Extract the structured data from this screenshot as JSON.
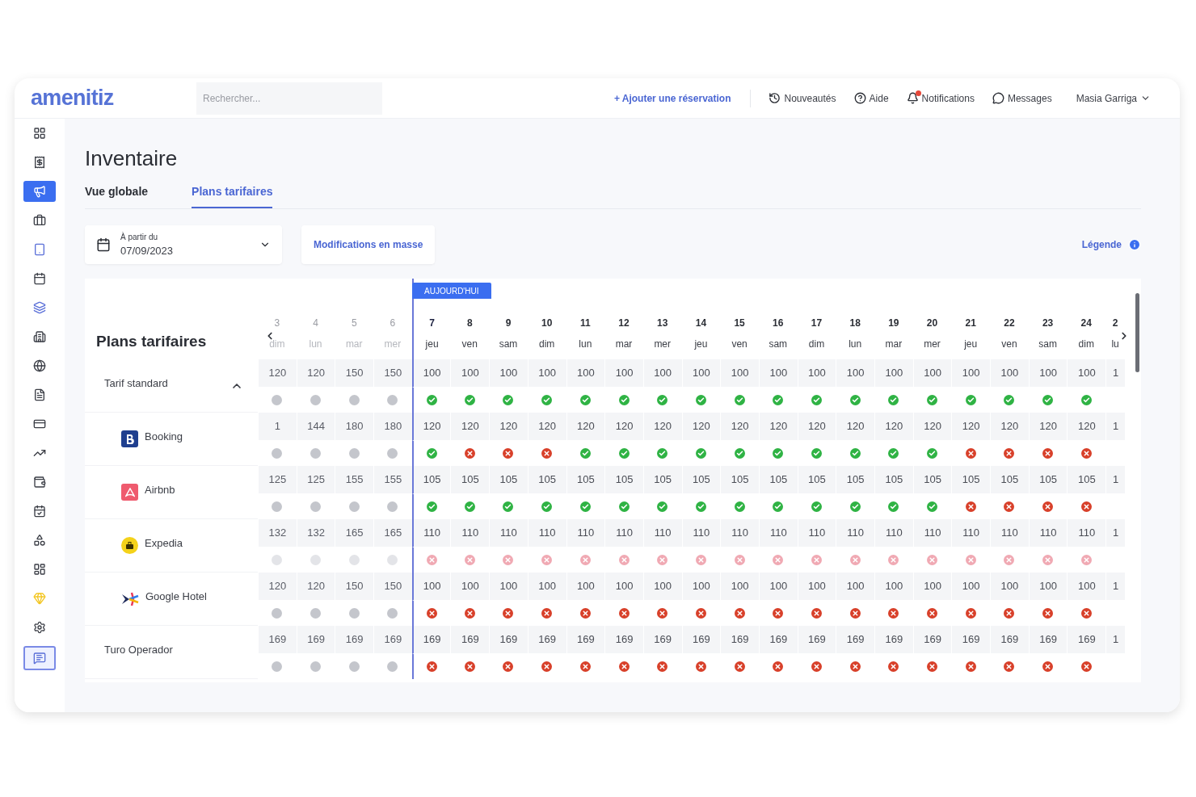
{
  "header": {
    "logo": "amenitiz",
    "search": {
      "placeholder": "Rechercher..."
    },
    "add_booking": "+ Ajouter une réservation",
    "links": [
      {
        "label": "Nouveautés",
        "badge": false
      },
      {
        "label": "Aide",
        "badge": false
      },
      {
        "label": "Notifications",
        "badge": true
      },
      {
        "label": "Messages",
        "badge": false
      }
    ],
    "user": "Masia Garriga"
  },
  "sidebar": {
    "items": [
      {
        "selected": false
      },
      {
        "selected": false
      },
      {
        "selected": true
      },
      {
        "selected": false
      },
      {
        "selected": false
      },
      {
        "selected": false
      },
      {
        "selected": false
      },
      {
        "selected": false
      },
      {
        "selected": false
      },
      {
        "selected": false
      },
      {
        "selected": false
      },
      {
        "selected": false
      },
      {
        "selected": false
      },
      {
        "selected": false
      },
      {
        "selected": false
      },
      {
        "selected": false
      },
      {
        "selected": false
      },
      {
        "selected": false
      },
      {
        "selected": false
      }
    ]
  },
  "page": {
    "title": "Inventaire",
    "tabs": [
      {
        "label": "Vue globale",
        "selected": false
      },
      {
        "label": "Plans tarifaires",
        "selected": true
      }
    ]
  },
  "toolbar": {
    "date_label": "À partir du",
    "date_value": "07/09/2023",
    "bulk_button": "Modifications en masse",
    "legend": "Légende"
  },
  "grid": {
    "heading": "Plans tarifaires",
    "today_label": "AUJOURD'HUI",
    "days": [
      {
        "day": "3",
        "weekday": "dim",
        "past": true,
        "today": false
      },
      {
        "day": "4",
        "weekday": "lun",
        "past": true,
        "today": false
      },
      {
        "day": "5",
        "weekday": "mar",
        "past": true,
        "today": false
      },
      {
        "day": "6",
        "weekday": "mer",
        "past": true,
        "today": false
      },
      {
        "day": "7",
        "weekday": "jeu",
        "past": false,
        "today": true
      },
      {
        "day": "8",
        "weekday": "ven",
        "past": false,
        "today": false
      },
      {
        "day": "9",
        "weekday": "sam",
        "past": false,
        "today": false
      },
      {
        "day": "10",
        "weekday": "dim",
        "past": false,
        "today": false
      },
      {
        "day": "11",
        "weekday": "lun",
        "past": false,
        "today": false
      },
      {
        "day": "12",
        "weekday": "mar",
        "past": false,
        "today": false
      },
      {
        "day": "13",
        "weekday": "mer",
        "past": false,
        "today": false
      },
      {
        "day": "14",
        "weekday": "jeu",
        "past": false,
        "today": false
      },
      {
        "day": "15",
        "weekday": "ven",
        "past": false,
        "today": false
      },
      {
        "day": "16",
        "weekday": "sam",
        "past": false,
        "today": false
      },
      {
        "day": "17",
        "weekday": "dim",
        "past": false,
        "today": false
      },
      {
        "day": "18",
        "weekday": "lun",
        "past": false,
        "today": false
      },
      {
        "day": "19",
        "weekday": "mar",
        "past": false,
        "today": false
      },
      {
        "day": "20",
        "weekday": "mer",
        "past": false,
        "today": false
      },
      {
        "day": "21",
        "weekday": "jeu",
        "past": false,
        "today": false
      },
      {
        "day": "22",
        "weekday": "ven",
        "past": false,
        "today": false
      },
      {
        "day": "23",
        "weekday": "sam",
        "past": false,
        "today": false
      },
      {
        "day": "24",
        "weekday": "dim",
        "past": false,
        "today": false
      },
      {
        "day": "2",
        "weekday": "lu",
        "past": false,
        "today": false
      }
    ],
    "rate_plans": [
      {
        "name": "Tarif standard",
        "expanded": true,
        "prices": [
          "120",
          "120",
          "150",
          "150",
          "100",
          "100",
          "100",
          "100",
          "100",
          "100",
          "100",
          "100",
          "100",
          "100",
          "100",
          "100",
          "100",
          "100",
          "100",
          "100",
          "100",
          "100",
          "1"
        ],
        "statuses": [
          {
            "color": "#c4c6cc"
          },
          {
            "color": "#c4c6cc"
          },
          {
            "color": "#c4c6cc"
          },
          {
            "color": "#c4c6cc"
          },
          {
            "color": "#2fb344"
          },
          {
            "color": "#2fb344"
          },
          {
            "color": "#2fb344"
          },
          {
            "color": "#2fb344"
          },
          {
            "color": "#2fb344"
          },
          {
            "color": "#2fb344"
          },
          {
            "color": "#2fb344"
          },
          {
            "color": "#2fb344"
          },
          {
            "color": "#2fb344"
          },
          {
            "color": "#2fb344"
          },
          {
            "color": "#2fb344"
          },
          {
            "color": "#2fb344"
          },
          {
            "color": "#2fb344"
          },
          {
            "color": "#2fb344"
          },
          {
            "color": "#2fb344"
          },
          {
            "color": "#2fb344"
          },
          {
            "color": "#2fb344"
          },
          {
            "color": "#2fb344"
          }
        ],
        "children": [
          {
            "name": "Booking",
            "prices": [
              "1",
              "144",
              "180",
              "180",
              "120",
              "120",
              "120",
              "120",
              "120",
              "120",
              "120",
              "120",
              "120",
              "120",
              "120",
              "120",
              "120",
              "120",
              "120",
              "120",
              "120",
              "120",
              "1"
            ],
            "statuses": [
              {
                "color": "#c4c6cc"
              },
              {
                "color": "#c4c6cc"
              },
              {
                "color": "#c4c6cc"
              },
              {
                "color": "#c4c6cc"
              },
              {
                "color": "#2fb344"
              },
              {
                "color": "#d8402a"
              },
              {
                "color": "#d8402a"
              },
              {
                "color": "#d8402a"
              },
              {
                "color": "#2fb344"
              },
              {
                "color": "#2fb344"
              },
              {
                "color": "#2fb344"
              },
              {
                "color": "#2fb344"
              },
              {
                "color": "#2fb344"
              },
              {
                "color": "#2fb344"
              },
              {
                "color": "#2fb344"
              },
              {
                "color": "#2fb344"
              },
              {
                "color": "#2fb344"
              },
              {
                "color": "#2fb344"
              },
              {
                "color": "#d8402a"
              },
              {
                "color": "#d8402a"
              },
              {
                "color": "#d8402a"
              },
              {
                "color": "#d8402a"
              }
            ]
          },
          {
            "name": "Airbnb",
            "prices": [
              "125",
              "125",
              "155",
              "155",
              "105",
              "105",
              "105",
              "105",
              "105",
              "105",
              "105",
              "105",
              "105",
              "105",
              "105",
              "105",
              "105",
              "105",
              "105",
              "105",
              "105",
              "105",
              "1"
            ],
            "statuses": [
              {
                "color": "#c4c6cc"
              },
              {
                "color": "#c4c6cc"
              },
              {
                "color": "#c4c6cc"
              },
              {
                "color": "#c4c6cc"
              },
              {
                "color": "#2fb344"
              },
              {
                "color": "#2fb344"
              },
              {
                "color": "#2fb344"
              },
              {
                "color": "#2fb344"
              },
              {
                "color": "#2fb344"
              },
              {
                "color": "#2fb344"
              },
              {
                "color": "#2fb344"
              },
              {
                "color": "#2fb344"
              },
              {
                "color": "#2fb344"
              },
              {
                "color": "#2fb344"
              },
              {
                "color": "#2fb344"
              },
              {
                "color": "#2fb344"
              },
              {
                "color": "#2fb344"
              },
              {
                "color": "#2fb344"
              },
              {
                "color": "#d8402a"
              },
              {
                "color": "#d8402a"
              },
              {
                "color": "#d8402a"
              },
              {
                "color": "#d8402a"
              }
            ]
          },
          {
            "name": "Expedia",
            "prices": [
              "132",
              "132",
              "165",
              "165",
              "110",
              "110",
              "110",
              "110",
              "110",
              "110",
              "110",
              "110",
              "110",
              "110",
              "110",
              "110",
              "110",
              "110",
              "110",
              "110",
              "110",
              "110",
              "1"
            ],
            "statuses": [
              {
                "color": "#e3e4e8"
              },
              {
                "color": "#e3e4e8"
              },
              {
                "color": "#e3e4e8"
              },
              {
                "color": "#e3e4e8"
              },
              {
                "color": "#f0a9b3"
              },
              {
                "color": "#f0a9b3"
              },
              {
                "color": "#f0a9b3"
              },
              {
                "color": "#f0a9b3"
              },
              {
                "color": "#f0a9b3"
              },
              {
                "color": "#f0a9b3"
              },
              {
                "color": "#f0a9b3"
              },
              {
                "color": "#f0a9b3"
              },
              {
                "color": "#f0a9b3"
              },
              {
                "color": "#f0a9b3"
              },
              {
                "color": "#f0a9b3"
              },
              {
                "color": "#f0a9b3"
              },
              {
                "color": "#f0a9b3"
              },
              {
                "color": "#f0a9b3"
              },
              {
                "color": "#f0a9b3"
              },
              {
                "color": "#f0a9b3"
              },
              {
                "color": "#f0a9b3"
              },
              {
                "color": "#f0a9b3"
              }
            ]
          },
          {
            "name": "Google Hotel",
            "prices": [
              "120",
              "120",
              "150",
              "150",
              "100",
              "100",
              "100",
              "100",
              "100",
              "100",
              "100",
              "100",
              "100",
              "100",
              "100",
              "100",
              "100",
              "100",
              "100",
              "100",
              "100",
              "100",
              "1"
            ],
            "statuses": [
              {
                "color": "#c4c6cc"
              },
              {
                "color": "#c4c6cc"
              },
              {
                "color": "#c4c6cc"
              },
              {
                "color": "#c4c6cc"
              },
              {
                "color": "#d8402a"
              },
              {
                "color": "#d8402a"
              },
              {
                "color": "#d8402a"
              },
              {
                "color": "#d8402a"
              },
              {
                "color": "#d8402a"
              },
              {
                "color": "#d8402a"
              },
              {
                "color": "#d8402a"
              },
              {
                "color": "#d8402a"
              },
              {
                "color": "#d8402a"
              },
              {
                "color": "#d8402a"
              },
              {
                "color": "#d8402a"
              },
              {
                "color": "#d8402a"
              },
              {
                "color": "#d8402a"
              },
              {
                "color": "#d8402a"
              },
              {
                "color": "#d8402a"
              },
              {
                "color": "#d8402a"
              },
              {
                "color": "#d8402a"
              },
              {
                "color": "#d8402a"
              }
            ]
          }
        ]
      },
      {
        "name": "Turo Operador",
        "prices": [
          "169",
          "169",
          "169",
          "169",
          "169",
          "169",
          "169",
          "169",
          "169",
          "169",
          "169",
          "169",
          "169",
          "169",
          "169",
          "169",
          "169",
          "169",
          "169",
          "169",
          "169",
          "169",
          "1"
        ],
        "statuses": [
          {
            "color": "#c4c6cc"
          },
          {
            "color": "#c4c6cc"
          },
          {
            "color": "#c4c6cc"
          },
          {
            "color": "#c4c6cc"
          },
          {
            "color": "#d8402a"
          },
          {
            "color": "#d8402a"
          },
          {
            "color": "#d8402a"
          },
          {
            "color": "#d8402a"
          },
          {
            "color": "#d8402a"
          },
          {
            "color": "#d8402a"
          },
          {
            "color": "#d8402a"
          },
          {
            "color": "#d8402a"
          },
          {
            "color": "#d8402a"
          },
          {
            "color": "#d8402a"
          },
          {
            "color": "#d8402a"
          },
          {
            "color": "#d8402a"
          },
          {
            "color": "#d8402a"
          },
          {
            "color": "#d8402a"
          },
          {
            "color": "#d8402a"
          },
          {
            "color": "#d8402a"
          },
          {
            "color": "#d8402a"
          },
          {
            "color": "#d8402a"
          }
        ]
      }
    ]
  }
}
